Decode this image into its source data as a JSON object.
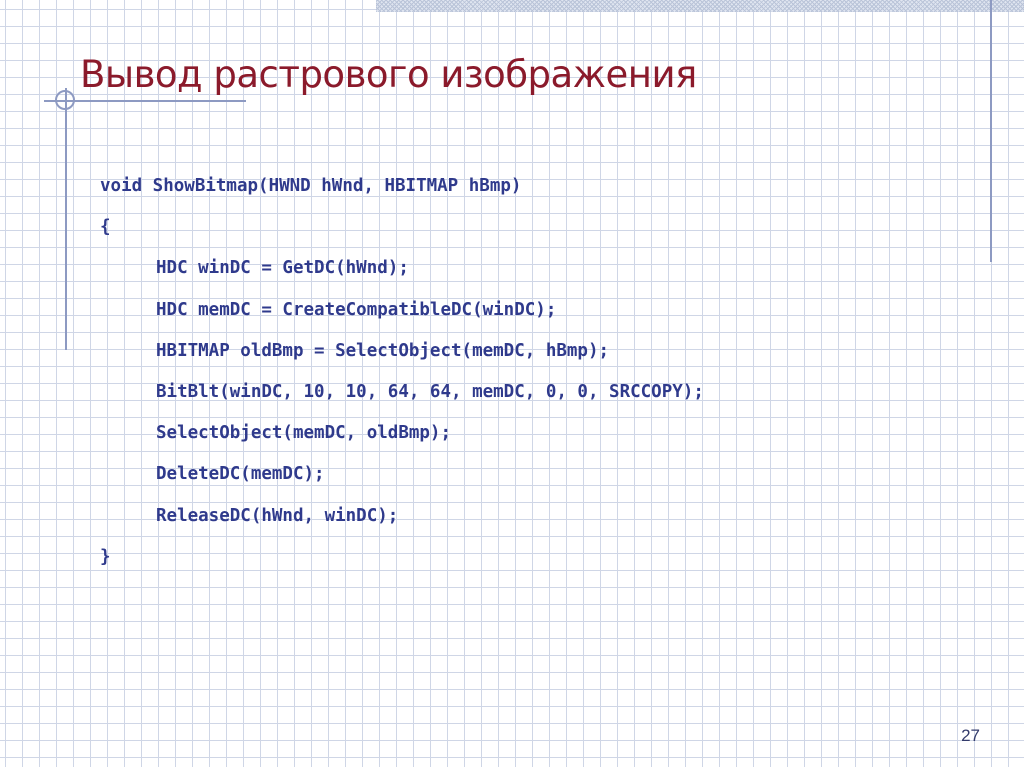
{
  "slide": {
    "title": "Вывод растрового изображения",
    "code_lines": [
      "void ShowBitmap(HWND hWnd, HBITMAP hBmp)",
      "{",
      "HDC winDC = GetDC(hWnd);",
      "HDC memDC = CreateCompatibleDC(winDC);",
      "HBITMAP oldBmp = SelectObject(memDC, hBmp);",
      "BitBlt(winDC, 10, 10, 64, 64, memDC, 0, 0, SRCCOPY);",
      "SelectObject(memDC, oldBmp);",
      "DeleteDC(memDC);",
      "ReleaseDC(hWnd, winDC);",
      "}"
    ],
    "page_number": "27"
  },
  "colors": {
    "title": "#8b1a2b",
    "code": "#2f3a8c",
    "accent_lines": "#8d9ac2",
    "grid": "#cfd6e6",
    "background": "#ffffff"
  }
}
